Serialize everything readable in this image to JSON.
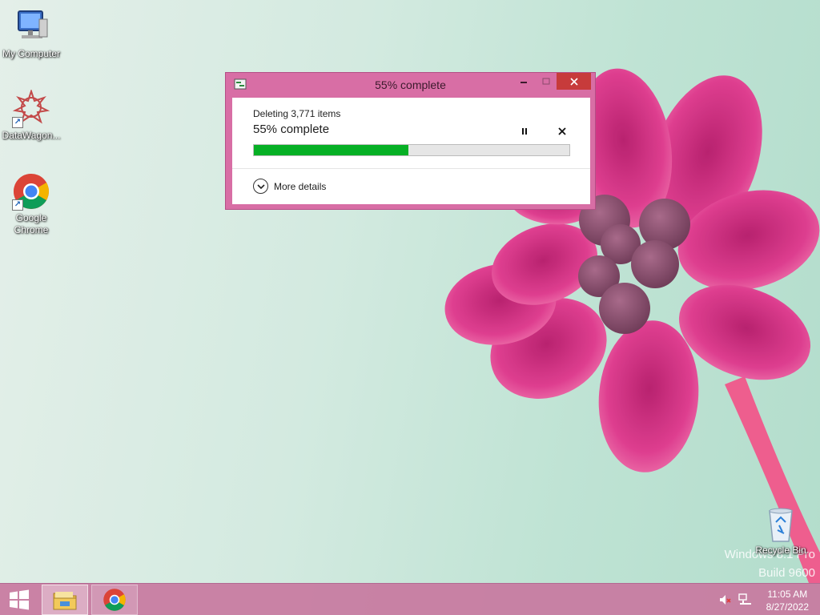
{
  "desktop": {
    "icons": [
      {
        "label": "My Computer",
        "icon": "computer-icon"
      },
      {
        "label": "DataWagon...",
        "icon": "datawagon-icon"
      },
      {
        "label": "Google Chrome",
        "icon": "chrome-icon"
      },
      {
        "label": "Recycle Bin",
        "icon": "recycle-bin-icon"
      }
    ],
    "watermark": {
      "line1": "Windows 8.1 Pro",
      "line2": "Build 9600"
    }
  },
  "dialog": {
    "title": "55% complete",
    "operation": "Deleting 3,771 items",
    "status": "55% complete",
    "progress": 0.49,
    "more_details": "More details",
    "accent": "#d86ea5",
    "progress_color": "#06b025"
  },
  "taskbar": {
    "apps": [
      {
        "name": "File Explorer",
        "icon": "file-explorer-icon"
      },
      {
        "name": "Google Chrome",
        "icon": "chrome-icon"
      }
    ],
    "tray": {
      "volume": "volume-muted-icon",
      "network": "network-icon"
    },
    "clock": {
      "time": "11:05 AM",
      "date": "8/27/2022"
    }
  }
}
